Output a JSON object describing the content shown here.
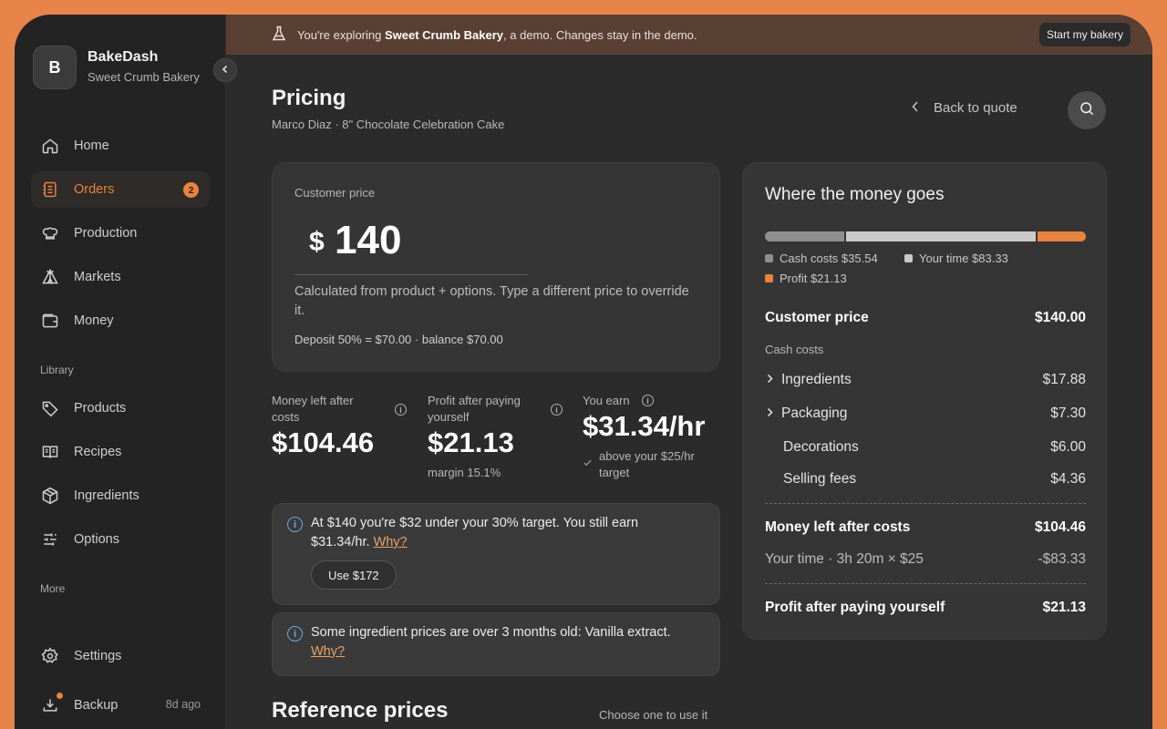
{
  "sidebar": {
    "logo_letter": "B",
    "brand": "BakeDash",
    "bakery": "Sweet Crumb Bakery",
    "nav": [
      {
        "label": "Home",
        "icon": "home-icon"
      },
      {
        "label": "Orders",
        "icon": "orders-icon",
        "badge": "2",
        "active": true
      },
      {
        "label": "Production",
        "icon": "chef-hat-icon"
      },
      {
        "label": "Markets",
        "icon": "tent-icon"
      },
      {
        "label": "Money",
        "icon": "wallet-icon"
      }
    ],
    "library_label": "Library",
    "library": [
      {
        "label": "Products",
        "icon": "tag-icon"
      },
      {
        "label": "Recipes",
        "icon": "book-icon"
      },
      {
        "label": "Ingredients",
        "icon": "package-icon"
      },
      {
        "label": "Options",
        "icon": "sliders-icon"
      }
    ],
    "more_label": "More",
    "settings": "Settings",
    "backup": "Backup",
    "backup_time": "8d ago"
  },
  "banner": {
    "prefix": "You're exploring ",
    "bakery": "Sweet Crumb Bakery",
    "suffix": ", a demo. Changes stay in the demo.",
    "button": "Start my bakery"
  },
  "header": {
    "title": "Pricing",
    "subtitle": "Marco Diaz · 8\" Chocolate Celebration Cake",
    "back": "Back to quote"
  },
  "price_card": {
    "label": "Customer price",
    "currency": "$",
    "value": "140",
    "help": "Calculated from product + options. Type a different price to override it.",
    "deposit": "Deposit 50% = $70.00 · balance $70.00"
  },
  "stats": {
    "money_left_label": "Money left after costs",
    "money_left_value": "$104.46",
    "profit_label": "Profit after paying yourself",
    "profit_value": "$21.13",
    "profit_sub": "margin 15.1%",
    "earn_label": "You earn",
    "earn_value": "$31.34/hr",
    "earn_sub": "above your $25/hr target"
  },
  "alerts": {
    "target": "At $140 you're $32 under your 30% target. You still earn $31.34/hr.",
    "target_link": "Why?",
    "use_button": "Use $172",
    "stale": "Some ingredient prices are over 3 months old: Vanilla extract.",
    "stale_link": "Why?"
  },
  "reference": {
    "title": "Reference prices",
    "hint": "Choose one to use it"
  },
  "breakdown": {
    "title": "Where the money goes",
    "bar": [
      {
        "name": "Cash costs",
        "value": 35.54,
        "color": "#8e8e8e"
      },
      {
        "name": "Your time",
        "value": 83.33,
        "color": "#c9c9c9"
      },
      {
        "name": "Profit",
        "value": 21.13,
        "color": "#e8823f"
      }
    ],
    "legend_cash": "Cash costs $35.54",
    "legend_time": "Your time $83.33",
    "legend_profit": "Profit $21.13",
    "customer_price_label": "Customer price",
    "customer_price_value": "$140.00",
    "cash_costs_label": "Cash costs",
    "ingredients_label": "Ingredients",
    "ingredients_value": "$17.88",
    "packaging_label": "Packaging",
    "packaging_value": "$7.30",
    "decorations_label": "Decorations",
    "decorations_value": "$6.00",
    "fees_label": "Selling fees",
    "fees_value": "$4.36",
    "money_left_label": "Money left after costs",
    "money_left_value": "$104.46",
    "time_label": "Your time · 3h 20m × $25",
    "time_value": "-$83.33",
    "profit_label": "Profit after paying yourself",
    "profit_value": "$21.13"
  }
}
